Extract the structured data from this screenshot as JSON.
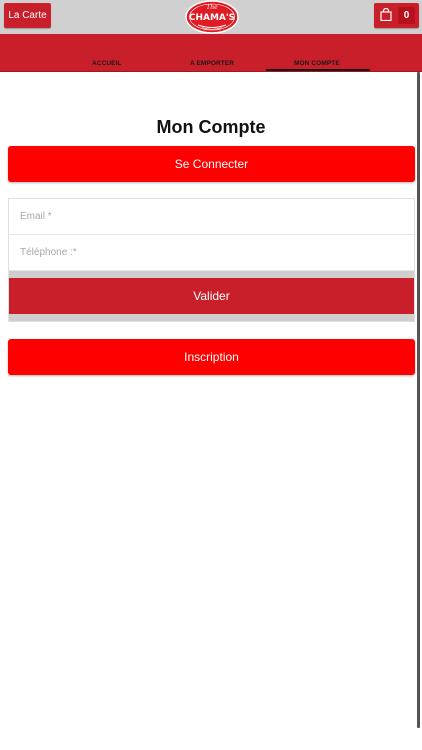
{
  "header": {
    "menu_button_label": "La Carte",
    "logo": {
      "top_text": "The",
      "main_text": "CHAMA'S"
    },
    "cart_count": "0",
    "colors": {
      "accent": "#c81f2a",
      "primary_button": "#ff0000",
      "topbar": "#d0d0d0"
    }
  },
  "nav": {
    "tabs": [
      {
        "label": "ACCUEIL"
      },
      {
        "label": "A EMPORTER"
      },
      {
        "label": "MON COMPTE"
      }
    ],
    "active_tab": "MON COMPTE"
  },
  "main": {
    "title": "Mon Compte",
    "connect_label": "Se Connecter",
    "form": {
      "email_placeholder": "Email *",
      "phone_placeholder": "Téléphone :*",
      "submit_label": "Valider"
    },
    "signup_label": "Inscription"
  },
  "icons": {
    "cart": "shopping-bag-icon"
  }
}
